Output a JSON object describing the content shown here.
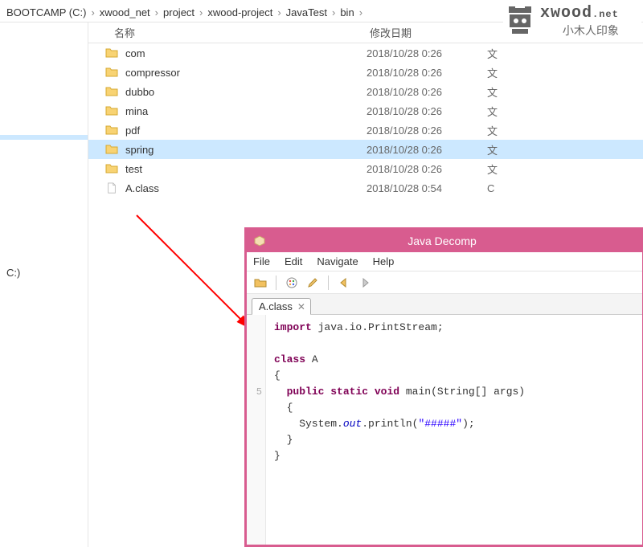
{
  "breadcrumb": [
    "BOOTCAMP (C:)",
    "xwood_net",
    "project",
    "xwood-project",
    "JavaTest",
    "bin"
  ],
  "columns": {
    "name": "名称",
    "date": "修改日期",
    "type": ""
  },
  "files": [
    {
      "name": "com",
      "date": "2018/10/28 0:26",
      "type": "文",
      "kind": "folder",
      "selected": false
    },
    {
      "name": "compressor",
      "date": "2018/10/28 0:26",
      "type": "文",
      "kind": "folder",
      "selected": false
    },
    {
      "name": "dubbo",
      "date": "2018/10/28 0:26",
      "type": "文",
      "kind": "folder",
      "selected": false
    },
    {
      "name": "mina",
      "date": "2018/10/28 0:26",
      "type": "文",
      "kind": "folder",
      "selected": false
    },
    {
      "name": "pdf",
      "date": "2018/10/28 0:26",
      "type": "文",
      "kind": "folder",
      "selected": false
    },
    {
      "name": "spring",
      "date": "2018/10/28 0:26",
      "type": "文",
      "kind": "folder",
      "selected": true
    },
    {
      "name": "test",
      "date": "2018/10/28 0:26",
      "type": "文",
      "kind": "folder",
      "selected": false
    },
    {
      "name": "A.class",
      "date": "2018/10/28 0:54",
      "type": "C",
      "kind": "file",
      "selected": false
    }
  ],
  "sidebar": {
    "item1": "",
    "item2": "C:)"
  },
  "watermark": {
    "main": "xwood",
    "dot": ".net",
    "sub": "小木人印象"
  },
  "decompiler": {
    "title": "Java Decomp",
    "menus": [
      "File",
      "Edit",
      "Navigate",
      "Help"
    ],
    "tab": "A.class",
    "gutter": [
      "",
      "",
      "",
      "",
      "5",
      "",
      "",
      ""
    ],
    "code_tokens": [
      [
        {
          "t": "kw",
          "v": "import"
        },
        {
          "t": "p",
          "v": " java.io.PrintStream;"
        }
      ],
      [
        {
          "t": "p",
          "v": ""
        }
      ],
      [
        {
          "t": "kw",
          "v": "class"
        },
        {
          "t": "p",
          "v": " A"
        }
      ],
      [
        {
          "t": "p",
          "v": "{"
        }
      ],
      [
        {
          "t": "p",
          "v": "  "
        },
        {
          "t": "kw",
          "v": "public"
        },
        {
          "t": "p",
          "v": " "
        },
        {
          "t": "kw",
          "v": "static"
        },
        {
          "t": "p",
          "v": " "
        },
        {
          "t": "kw",
          "v": "void"
        },
        {
          "t": "p",
          "v": " main(String[] args)"
        }
      ],
      [
        {
          "t": "p",
          "v": "  {"
        }
      ],
      [
        {
          "t": "p",
          "v": "    System."
        },
        {
          "t": "si",
          "v": "out"
        },
        {
          "t": "p",
          "v": ".println("
        },
        {
          "t": "str",
          "v": "\"#####\""
        },
        {
          "t": "p",
          "v": ");"
        }
      ],
      [
        {
          "t": "p",
          "v": "  }"
        }
      ],
      [
        {
          "t": "p",
          "v": "}"
        }
      ]
    ]
  }
}
